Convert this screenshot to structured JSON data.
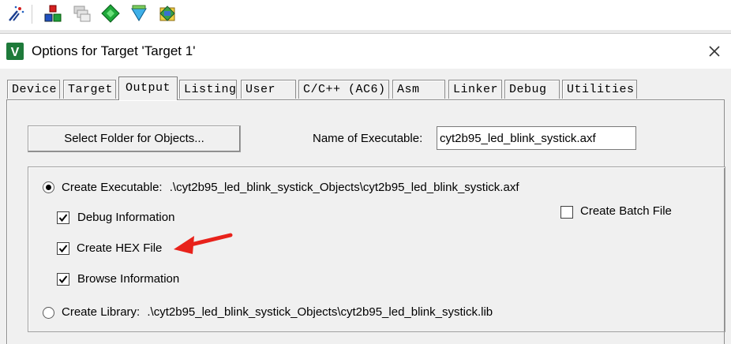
{
  "window": {
    "title": "Options for Target 'Target 1'"
  },
  "toolbar": {
    "icons": [
      "magic-wand-icon",
      "target-options-icon",
      "multi-project-icon",
      "diamond-icon",
      "manage-components-icon",
      "pack-installer-icon"
    ]
  },
  "tabs": [
    {
      "label": "Device"
    },
    {
      "label": "Target"
    },
    {
      "label": "Output",
      "active": true
    },
    {
      "label": "Listing"
    },
    {
      "label": "User"
    },
    {
      "label": "C/C++ (AC6)"
    },
    {
      "label": "Asm"
    },
    {
      "label": "Linker"
    },
    {
      "label": "Debug"
    },
    {
      "label": "Utilities"
    }
  ],
  "output": {
    "select_folder_label": "Select Folder for Objects...",
    "name_label": "Name of Executable:",
    "executable_name": "cyt2b95_led_blink_systick.axf",
    "create_executable_label": "Create Executable:",
    "create_executable_path": ".\\cyt2b95_led_blink_systick_Objects\\cyt2b95_led_blink_systick.axf",
    "create_executable_selected": true,
    "debug_info_label": "Debug Information",
    "debug_info_checked": true,
    "create_hex_label": "Create HEX File",
    "create_hex_checked": true,
    "browse_info_label": "Browse Information",
    "browse_info_checked": true,
    "create_batch_label": "Create Batch File",
    "create_batch_checked": false,
    "create_library_label": "Create Library:",
    "create_library_path": ".\\cyt2b95_led_blink_systick_Objects\\cyt2b95_led_blink_systick.lib",
    "create_library_selected": false
  },
  "annotation": {
    "arrow_color": "#e8221b"
  }
}
